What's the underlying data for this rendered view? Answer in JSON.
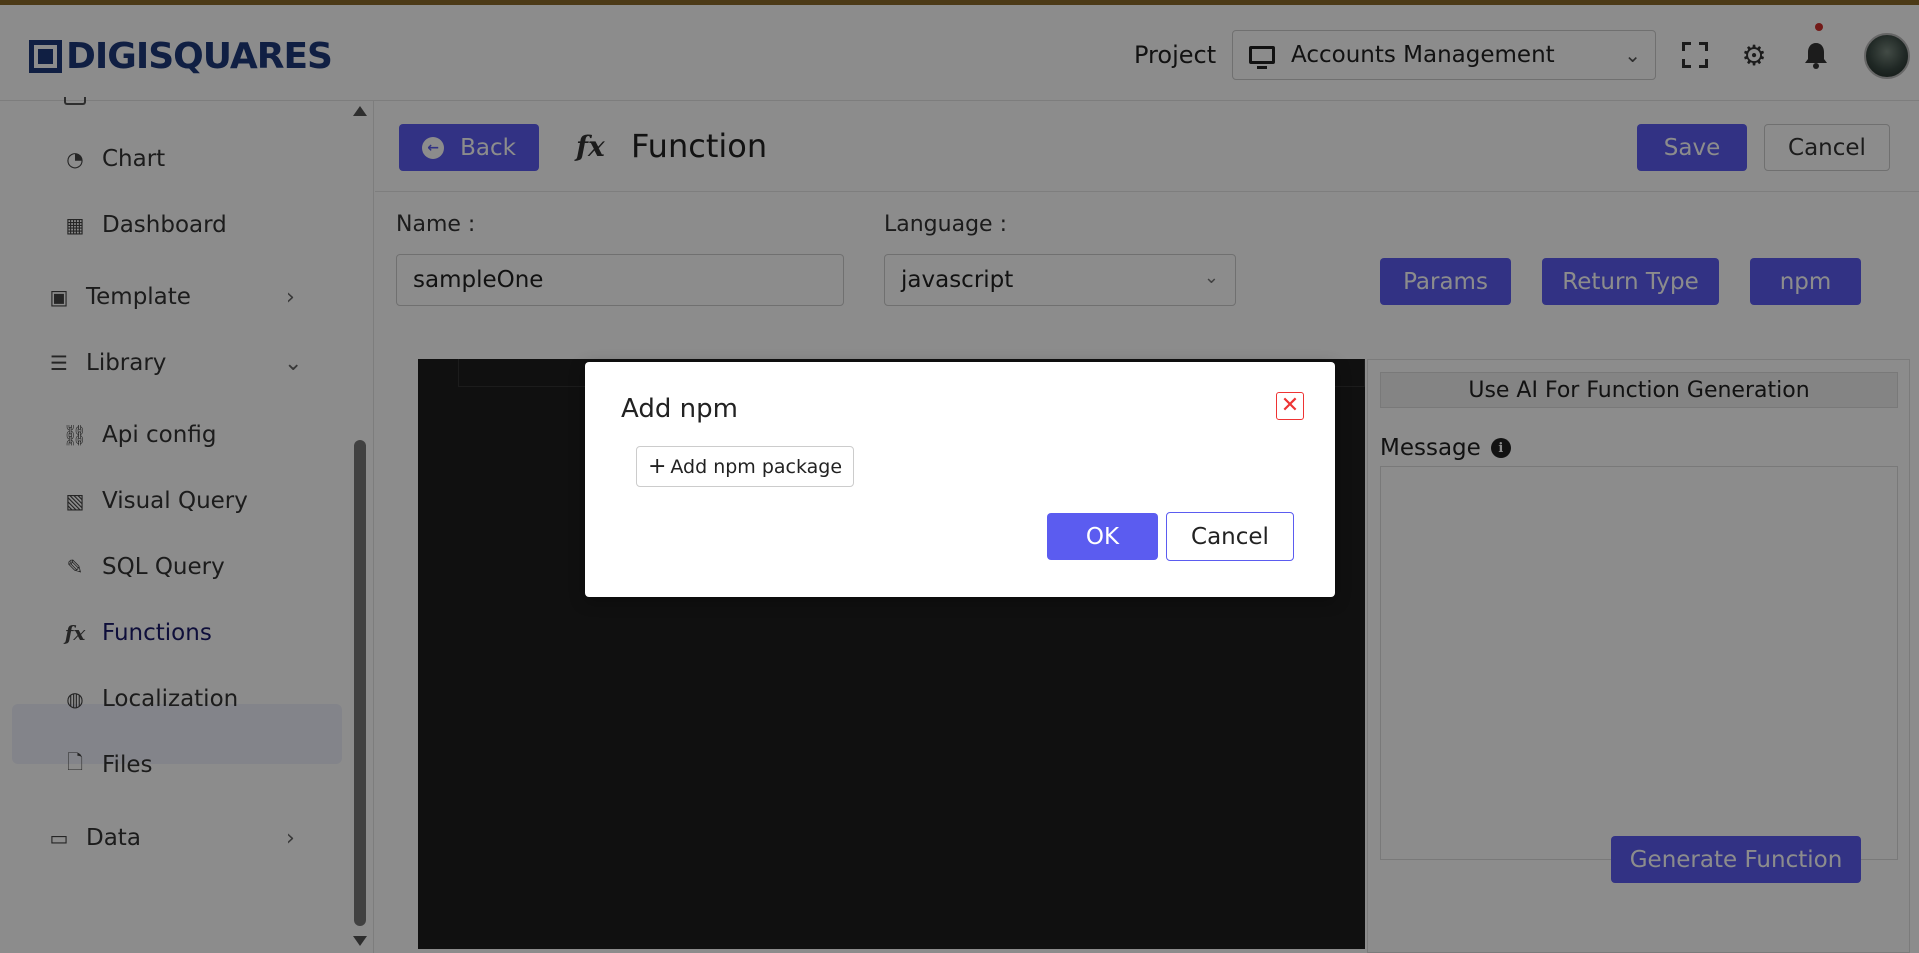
{
  "header": {
    "logo_text": "DIGISQUARES",
    "project_label": "Project",
    "project_value": "Accounts Management"
  },
  "sidebar": {
    "items": [
      {
        "label": "Chart",
        "icon": "chart-pie-icon"
      },
      {
        "label": "Dashboard",
        "icon": "dashboard-icon"
      },
      {
        "label": "Template",
        "icon": "template-icon"
      },
      {
        "label": "Library",
        "icon": "library-icon"
      },
      {
        "label": "Api config",
        "icon": "api-icon"
      },
      {
        "label": "Visual Query",
        "icon": "visual-query-icon"
      },
      {
        "label": "SQL Query",
        "icon": "sql-icon"
      },
      {
        "label": "Functions",
        "icon": "function-icon"
      },
      {
        "label": "Localization",
        "icon": "globe-icon"
      },
      {
        "label": "Files",
        "icon": "file-icon"
      },
      {
        "label": "Data",
        "icon": "data-icon"
      }
    ]
  },
  "toolbar": {
    "back_label": "Back",
    "fx_symbol": "fx",
    "title": "Function",
    "save_label": "Save",
    "cancel_label": "Cancel"
  },
  "form": {
    "name_label": "Name :",
    "name_value": "sampleOne",
    "language_label": "Language :",
    "language_value": "javascript",
    "params_label": "Params",
    "return_type_label": "Return Type",
    "npm_label": "npm"
  },
  "ai_panel": {
    "title": "Use AI For Function Generation",
    "message_label": "Message",
    "generate_label": "Generate Function"
  },
  "modal": {
    "title": "Add npm",
    "add_package_label": "Add npm package",
    "ok_label": "OK",
    "cancel_label": "Cancel"
  },
  "colors": {
    "primary": "#5b5cf0",
    "brand": "#1e3a7a",
    "danger": "#e33333"
  }
}
